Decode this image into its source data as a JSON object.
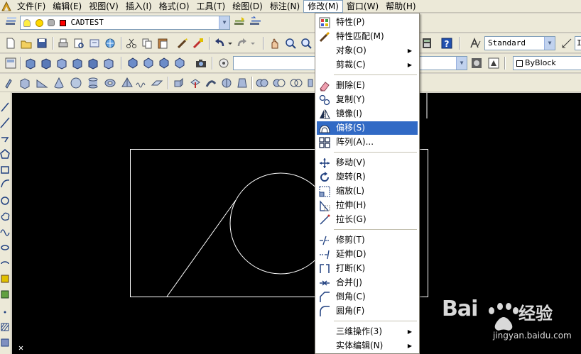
{
  "menubar": {
    "items": [
      {
        "label": "文件(F)",
        "open": false
      },
      {
        "label": "编辑(E)",
        "open": false
      },
      {
        "label": "视图(V)",
        "open": false
      },
      {
        "label": "插入(I)",
        "open": false
      },
      {
        "label": "格式(O)",
        "open": false
      },
      {
        "label": "工具(T)",
        "open": false
      },
      {
        "label": "绘图(D)",
        "open": false
      },
      {
        "label": "标注(N)",
        "open": false
      },
      {
        "label": "修改(M)",
        "open": true
      },
      {
        "label": "窗口(W)",
        "open": false
      },
      {
        "label": "帮助(H)",
        "open": false
      }
    ]
  },
  "layer_toolbar": {
    "layer_name": "CADTEST",
    "layer_color": "#ff0000"
  },
  "styles_toolbar": {
    "text_style": "Standard",
    "dim_style_partial": "I"
  },
  "properties_toolbar": {
    "color_control": "ByBlock"
  },
  "modify_menu": {
    "items": [
      {
        "label": "特性(P)",
        "icon": "properties-icon",
        "submenu": false,
        "highlighted": false
      },
      {
        "label": "特性匹配(M)",
        "icon": "match-brush-icon",
        "submenu": false,
        "highlighted": false
      },
      {
        "label": "对象(O)",
        "icon": "",
        "submenu": true,
        "highlighted": false
      },
      {
        "label": "剪裁(C)",
        "icon": "",
        "submenu": true,
        "highlighted": false
      },
      {
        "label": "删除(E)",
        "icon": "eraser-icon",
        "submenu": false,
        "highlighted": false
      },
      {
        "label": "复制(Y)",
        "icon": "copy-icon",
        "submenu": false,
        "highlighted": false
      },
      {
        "label": "镜像(I)",
        "icon": "mirror-icon",
        "submenu": false,
        "highlighted": false
      },
      {
        "label": "偏移(S)",
        "icon": "offset-icon",
        "submenu": false,
        "highlighted": true
      },
      {
        "label": "阵列(A)...",
        "icon": "array-icon",
        "submenu": false,
        "highlighted": false
      },
      {
        "label": "移动(V)",
        "icon": "move-icon",
        "submenu": false,
        "highlighted": false
      },
      {
        "label": "旋转(R)",
        "icon": "rotate-icon",
        "submenu": false,
        "highlighted": false
      },
      {
        "label": "缩放(L)",
        "icon": "scale-icon",
        "submenu": false,
        "highlighted": false
      },
      {
        "label": "拉伸(H)",
        "icon": "stretch-icon",
        "submenu": false,
        "highlighted": false
      },
      {
        "label": "拉长(G)",
        "icon": "lengthen-icon",
        "submenu": false,
        "highlighted": false
      },
      {
        "label": "修剪(T)",
        "icon": "trim-icon",
        "submenu": false,
        "highlighted": false
      },
      {
        "label": "延伸(D)",
        "icon": "extend-icon",
        "submenu": false,
        "highlighted": false
      },
      {
        "label": "打断(K)",
        "icon": "break-icon",
        "submenu": false,
        "highlighted": false
      },
      {
        "label": "合并(J)",
        "icon": "join-icon",
        "submenu": false,
        "highlighted": false
      },
      {
        "label": "倒角(C)",
        "icon": "chamfer-icon",
        "submenu": false,
        "highlighted": false
      },
      {
        "label": "圆角(F)",
        "icon": "fillet-icon",
        "submenu": false,
        "highlighted": false
      },
      {
        "label": "三维操作(3)",
        "icon": "",
        "submenu": true,
        "highlighted": false
      },
      {
        "label": "实体编辑(N)",
        "icon": "",
        "submenu": true,
        "highlighted": false
      }
    ]
  },
  "watermark": {
    "brand_text": "Bai",
    "brand_suffix": "经验",
    "url": "jingyan.baidu.com"
  },
  "colors": {
    "menu_highlight": "#316ac5",
    "canvas_bg": "#000000",
    "geometry_stroke": "#ffffff"
  }
}
